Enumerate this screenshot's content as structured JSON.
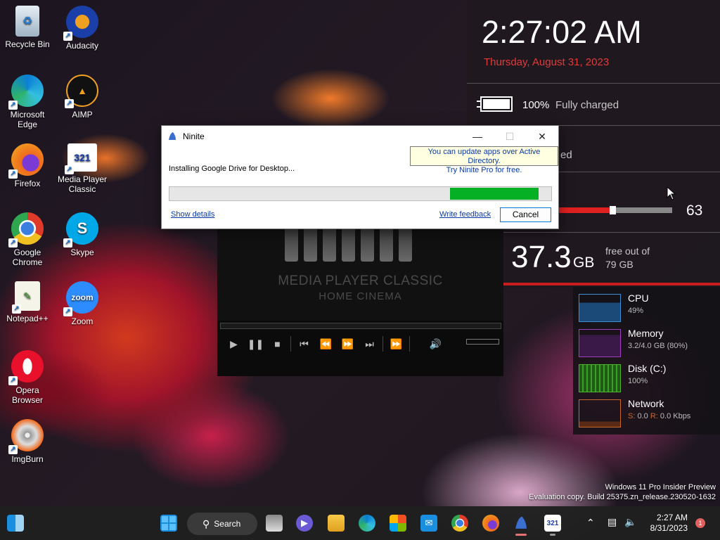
{
  "desktop": {
    "icons": [
      {
        "label": "Recycle Bin"
      },
      {
        "label": "Audacity"
      },
      {
        "label": "Microsoft Edge"
      },
      {
        "label": "AIMP"
      },
      {
        "label": "Firefox"
      },
      {
        "label": "Media Player Classic"
      },
      {
        "label": "Google Chrome"
      },
      {
        "label": "Skype"
      },
      {
        "label": "Notepad++"
      },
      {
        "label": "Zoom"
      },
      {
        "label": "Opera Browser"
      },
      {
        "label": "ImgBurn"
      }
    ],
    "skype_glyph": "S",
    "zoom_glyph": "zoom",
    "mpc_glyph": "321",
    "watermark": {
      "line1": "Windows 11 Pro Insider Preview",
      "line2": "Evaluation copy. Build 25375.zn_release.230520-1632"
    }
  },
  "ninite": {
    "title": "Ninite",
    "tooltip_line1": "You can update apps over Active Directory.",
    "tooltip_line2": "Try Ninite Pro for free.",
    "status": "Installing Google Drive for Desktop...",
    "progress_start_fraction": 0.735,
    "progress_end_fraction": 0.967,
    "show_details": "Show details",
    "write_feedback": "Write feedback",
    "cancel": "Cancel",
    "minimize_glyph": "—",
    "maximize_glyph": "☐",
    "close_glyph": "✕"
  },
  "media_player": {
    "logo_line1": "MEDIA PLAYER CLASSIC",
    "logo_line2": "HOME CINEMA"
  },
  "widgets": {
    "clock": "2:27:02 AM",
    "date": "Thursday, August 31, 2023",
    "battery_percent": "100%",
    "battery_status": "Fully charged",
    "partial_text": "ed",
    "volume_value": "63",
    "volume_fraction": 0.45,
    "disk_free_value": "37.3",
    "disk_unit": "GB",
    "disk_free_line1": "free out of",
    "disk_free_line2": "79 GB",
    "monitors": [
      {
        "name": "CPU",
        "value": "49%",
        "color": "#3a8fd6"
      },
      {
        "name": "Memory",
        "value": "3.2/4.0 GB (80%)",
        "color": "#a040c0"
      },
      {
        "name": "Disk (C:)",
        "value": "100%",
        "color": "#4cb830"
      },
      {
        "name": "Network",
        "value_s_label": "S:",
        "value_s": "0.0",
        "value_r_label": "R:",
        "value_r": "0.0 Kbps",
        "color": "#c86a30"
      }
    ]
  },
  "taskbar": {
    "search_label": "Search",
    "time": "2:27 AM",
    "date": "8/31/2023",
    "notification_count": "1",
    "colors": {
      "accent": "#0078d4",
      "red_accent": "#e23a3a"
    }
  }
}
